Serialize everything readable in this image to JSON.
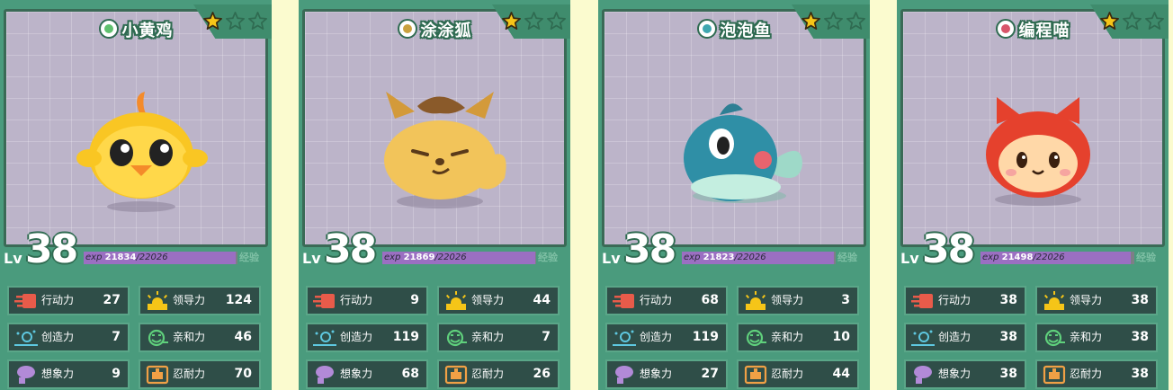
{
  "cards": [
    {
      "name": "小黄鸡",
      "level": "38",
      "lv_prefix": "Lv",
      "exp_prefix": "exp",
      "exp_current": "21834",
      "exp_total": "/22026",
      "exp_ratio": 0.991,
      "exp_word": "经验",
      "stars_filled": 1,
      "stars_total": 3,
      "type_icon": "leaf-swirl-icon",
      "accent": "#4fc06e",
      "stats": {
        "action": {
          "label": "行动力",
          "value": "27"
        },
        "leadership": {
          "label": "领导力",
          "value": "124"
        },
        "creativity": {
          "label": "创造力",
          "value": "7"
        },
        "affinity": {
          "label": "亲和力",
          "value": "46"
        },
        "imagination": {
          "label": "想象力",
          "value": "9"
        },
        "endurance": {
          "label": "忍耐力",
          "value": "70"
        }
      }
    },
    {
      "name": "涂涂狐",
      "level": "38",
      "lv_prefix": "Lv",
      "exp_prefix": "exp",
      "exp_current": "21869",
      "exp_total": "/22026",
      "exp_ratio": 0.993,
      "exp_word": "经验",
      "stars_filled": 1,
      "stars_total": 3,
      "type_icon": "earth-mound-icon",
      "accent": "#c9a13f",
      "stats": {
        "action": {
          "label": "行动力",
          "value": "9"
        },
        "leadership": {
          "label": "领导力",
          "value": "44"
        },
        "creativity": {
          "label": "创造力",
          "value": "119"
        },
        "affinity": {
          "label": "亲和力",
          "value": "7"
        },
        "imagination": {
          "label": "想象力",
          "value": "68"
        },
        "endurance": {
          "label": "忍耐力",
          "value": "26"
        }
      }
    },
    {
      "name": "泡泡鱼",
      "level": "38",
      "lv_prefix": "Lv",
      "exp_prefix": "exp",
      "exp_current": "21823",
      "exp_total": "/22026",
      "exp_ratio": 0.991,
      "exp_word": "经验",
      "stars_filled": 1,
      "stars_total": 3,
      "type_icon": "water-swirl-icon",
      "accent": "#3fa7b0",
      "stats": {
        "action": {
          "label": "行动力",
          "value": "68"
        },
        "leadership": {
          "label": "领导力",
          "value": "3"
        },
        "creativity": {
          "label": "创造力",
          "value": "119"
        },
        "affinity": {
          "label": "亲和力",
          "value": "10"
        },
        "imagination": {
          "label": "想象力",
          "value": "27"
        },
        "endurance": {
          "label": "忍耐力",
          "value": "44"
        }
      }
    },
    {
      "name": "编程喵",
      "level": "38",
      "lv_prefix": "Lv",
      "exp_prefix": "exp",
      "exp_current": "21498",
      "exp_total": "/22026",
      "exp_ratio": 0.976,
      "exp_word": "经验",
      "stars_filled": 1,
      "stars_total": 3,
      "type_icon": "fire-flame-icon",
      "accent": "#d8556a",
      "stats": {
        "action": {
          "label": "行动力",
          "value": "38"
        },
        "leadership": {
          "label": "领导力",
          "value": "38"
        },
        "creativity": {
          "label": "创造力",
          "value": "38"
        },
        "affinity": {
          "label": "亲和力",
          "value": "38"
        },
        "imagination": {
          "label": "想象力",
          "value": "38"
        },
        "endurance": {
          "label": "忍耐力",
          "value": "38"
        }
      }
    }
  ],
  "colors": {
    "page_bg": "#fbfbcf",
    "card_frame": "#4a9b7d",
    "portrait_bg": "#bcb4c9",
    "stat_bg": "#2f4e48",
    "exp_fill": "#9b6fc2",
    "star_gold": "#f5c518"
  }
}
